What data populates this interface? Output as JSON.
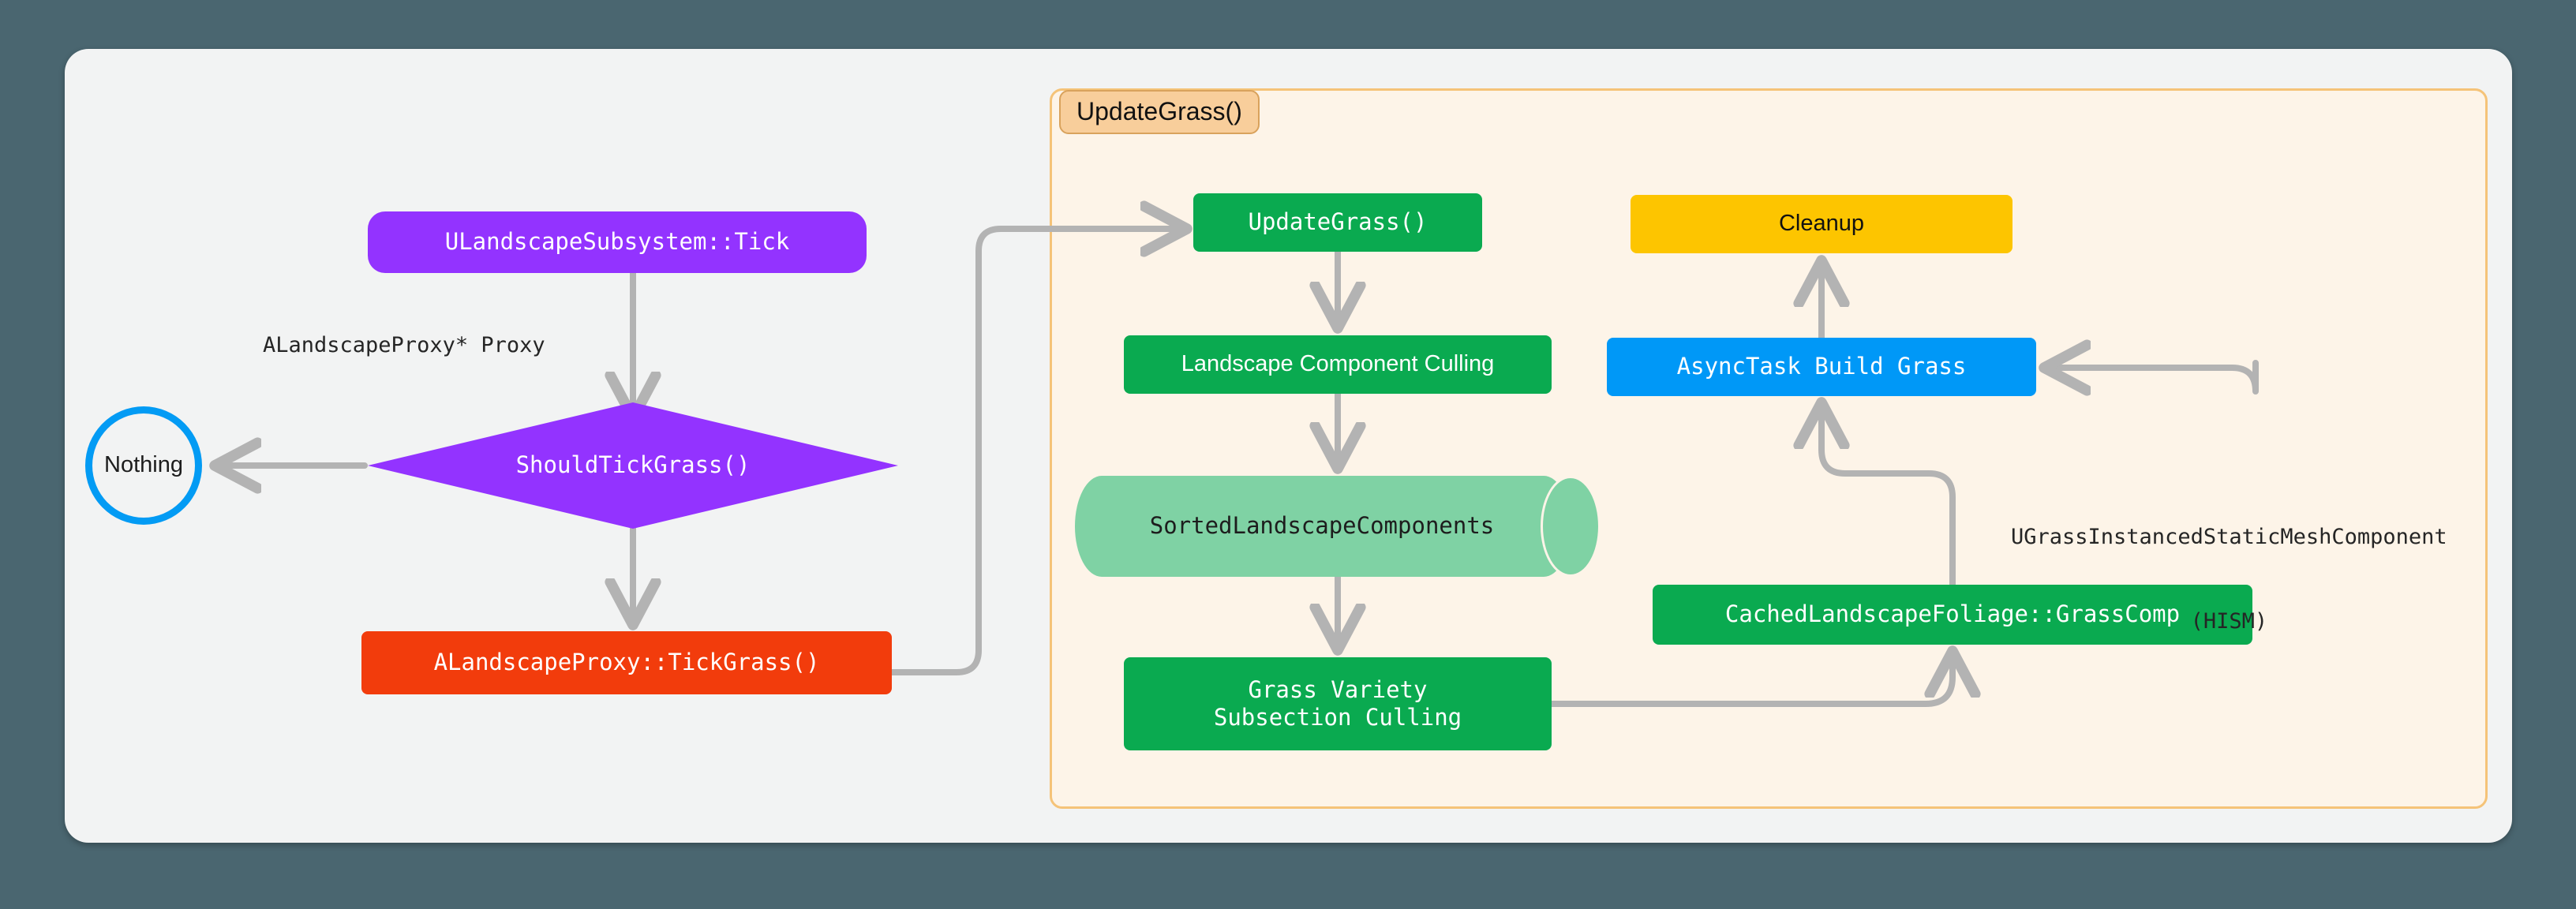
{
  "canvas": {
    "background_color": "#4a6670",
    "card_color": "#f2f3f3"
  },
  "subgraph": {
    "label": "UpdateGrass()",
    "fill_color": "#fdf4e8",
    "border_color": "#f5c378",
    "label_fill_color": "#f8ce9b"
  },
  "nodes": {
    "tick": {
      "label": "ULandscapeSubsystem::Tick",
      "shape": "stadium",
      "color": "#9333ff",
      "text_color": "#ffffff"
    },
    "should_tick_grass": {
      "label": "ShouldTickGrass()",
      "shape": "diamond",
      "color": "#9333ff",
      "text_color": "#ffffff"
    },
    "nothing": {
      "label": "Nothing",
      "shape": "circle",
      "color": "#f2f3f3",
      "border_color": "#039bf4",
      "text_color": "#1d1d1d"
    },
    "tick_grass": {
      "label": "ALandscapeProxy::TickGrass()",
      "shape": "rect",
      "color": "#f23c0c",
      "text_color": "#ffffff"
    },
    "update_grass": {
      "label": "UpdateGrass()",
      "shape": "rect",
      "color": "#0aaa50",
      "text_color": "#ffffff"
    },
    "landscape_component_culling": {
      "label": "Landscape Component Culling",
      "shape": "rect",
      "color": "#0aaa50",
      "text_color": "#ffffff"
    },
    "sorted_landscape_components": {
      "label": "SortedLandscapeComponents",
      "shape": "cylinder",
      "color": "#7fd2a4",
      "text_color": "#1d1d1d"
    },
    "grass_variety_subsection_culling": {
      "label_line1": "Grass Variety",
      "label_line2": "Subsection Culling",
      "shape": "rect",
      "color": "#0aaa50",
      "text_color": "#ffffff"
    },
    "cached_landscape_foliage": {
      "label": "CachedLandscapeFoliage::GrassComp",
      "shape": "rect",
      "color": "#0aaa50",
      "text_color": "#ffffff"
    },
    "async_task_build_grass": {
      "label": "AsyncTask Build Grass",
      "shape": "rect",
      "color": "#0098f7",
      "text_color": "#ffffff"
    },
    "cleanup": {
      "label": "Cleanup",
      "shape": "rect",
      "color": "#fdc500",
      "text_color": "#111111"
    }
  },
  "edge_labels": {
    "proxy": "ALandscapeProxy* Proxy",
    "hism_line1": "UGrassInstancedStaticMeshComponent",
    "hism_line2": "(HISM)"
  },
  "edges": {
    "stroke_color": "#b3b3b3"
  }
}
